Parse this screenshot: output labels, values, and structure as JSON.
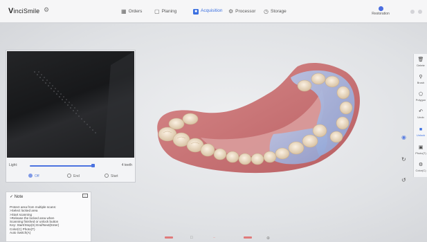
{
  "app": {
    "logo_initial": "V",
    "logo_rest": "inciSmile",
    "logo_gear_icon": "gear-icon"
  },
  "nav": {
    "items": [
      {
        "label": "Orders",
        "icon": "grid-icon"
      },
      {
        "label": "Planing",
        "icon": "bracket-icon"
      },
      {
        "label": "Acquisition",
        "icon": "scan-icon",
        "active": true
      },
      {
        "label": "Processor",
        "icon": "gear-icon"
      },
      {
        "label": "Storage",
        "icon": "clock-icon"
      }
    ],
    "restoration_label": "Restoration"
  },
  "camera": {
    "light_label": "Light:",
    "light_fraction": 0.95,
    "teeth_label": "4 teeth",
    "controls": [
      {
        "label": "Off",
        "icon": "power-icon",
        "active": true
      },
      {
        "label": "End",
        "icon": "stop-icon"
      },
      {
        "label": "Start",
        "icon": "play-icon"
      }
    ]
  },
  "note": {
    "title": "Note",
    "lines": [
      "Protect area from multiple scans:",
      ">Select locked area",
      ">Start scanning",
      ">Release the locked area when",
      "  Scanning finished or unlock button",
      "Key: Start/Stop(S) End/Next(Enter)",
      "  Color(C) Photo(T)",
      "  Auto Switch(A)"
    ]
  },
  "tools": [
    {
      "label": "Delete",
      "icon": "trash-icon"
    },
    {
      "label": "Brush",
      "icon": "brush-icon"
    },
    {
      "label": "Polygon",
      "icon": "polygon-icon"
    },
    {
      "label": "Undo",
      "icon": "undo-icon"
    },
    {
      "label": "Unlock",
      "icon": "lock-icon",
      "active": true
    },
    {
      "label": "Photo(T)",
      "icon": "photo-icon"
    },
    {
      "label": "Color(C)",
      "icon": "color-icon"
    }
  ],
  "colors": {
    "accent": "#3a6fe0",
    "gum": "#c56b6b",
    "tooth": "#e9d8c2",
    "scan_overlay": "#9fb3de"
  }
}
